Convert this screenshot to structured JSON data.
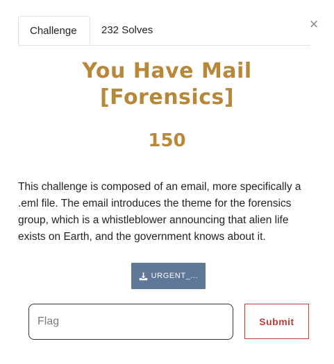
{
  "modal": {
    "close_glyph": "×",
    "tabs": [
      {
        "label": "Challenge",
        "active": true
      },
      {
        "label": "232 Solves",
        "active": false
      }
    ],
    "title_line1": "You Have Mail",
    "title_line2": "[Forensics]",
    "points": "150",
    "description": "This challenge is composed of an email, more specifically a .eml file. The email introduces the theme for the forensics group, which is a whistleblower announcing that alien life exists on Earth, and the government knows about it.",
    "download": {
      "label": "URGENT_...",
      "icon": "download-icon"
    },
    "flag_input": {
      "placeholder": "Flag",
      "value": ""
    },
    "submit_label": "Submit"
  },
  "colors": {
    "accent_gold": "#b98738",
    "download_bg": "#607897",
    "submit_red": "#c23b3b"
  }
}
